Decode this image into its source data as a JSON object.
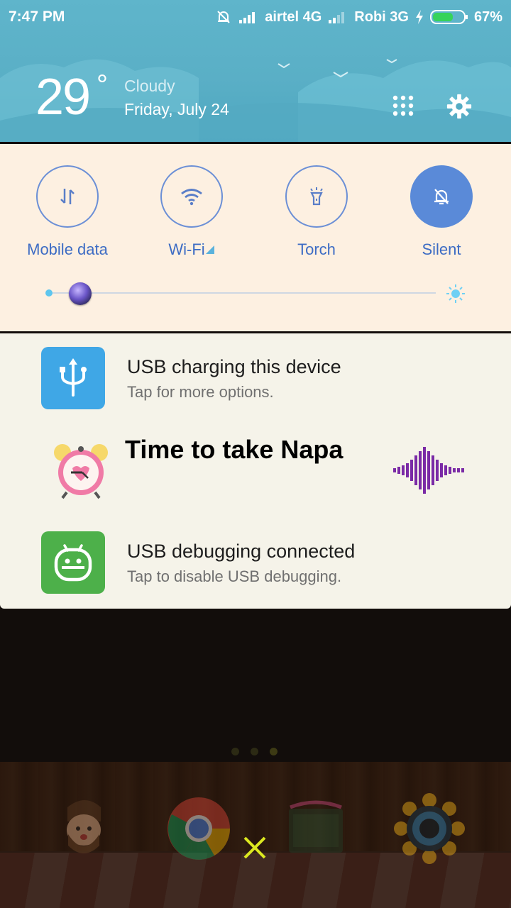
{
  "status_bar": {
    "time": "7:47 PM",
    "carrier1": "airtel 4G",
    "carrier2": "Robi 3G",
    "battery": "67%",
    "battery_level": 0.67
  },
  "weather": {
    "temperature": "29",
    "degree_symbol": "°",
    "condition": "Cloudy",
    "date": "Friday, July 24"
  },
  "quick_toggles": [
    {
      "label": "Mobile data",
      "icon": "mobile-data-icon",
      "active": false
    },
    {
      "label": "Wi-Fi",
      "icon": "wifi-icon",
      "active": false
    },
    {
      "label": "Torch",
      "icon": "torch-icon",
      "active": false
    },
    {
      "label": "Silent",
      "icon": "silent-bell-icon",
      "active": true
    }
  ],
  "brightness": {
    "level": 0.04
  },
  "notifications": [
    {
      "title": "USB charging this device",
      "subtitle": "Tap for more options.",
      "icon": "usb-icon",
      "icon_color": "#3fa7e6"
    },
    {
      "title": "Time to take Napa",
      "icon": "alarm-clock-icon"
    },
    {
      "title": "USB debugging connected",
      "subtitle": "Tap to disable USB debugging.",
      "icon": "android-debug-icon",
      "icon_color": "#4db04a"
    }
  ],
  "colors": {
    "header": "#5fb5cb",
    "toggle_panel": "#fdf0e1",
    "toggle_accent": "#5a8ad8",
    "notification_bg": "#f5f3e9"
  }
}
